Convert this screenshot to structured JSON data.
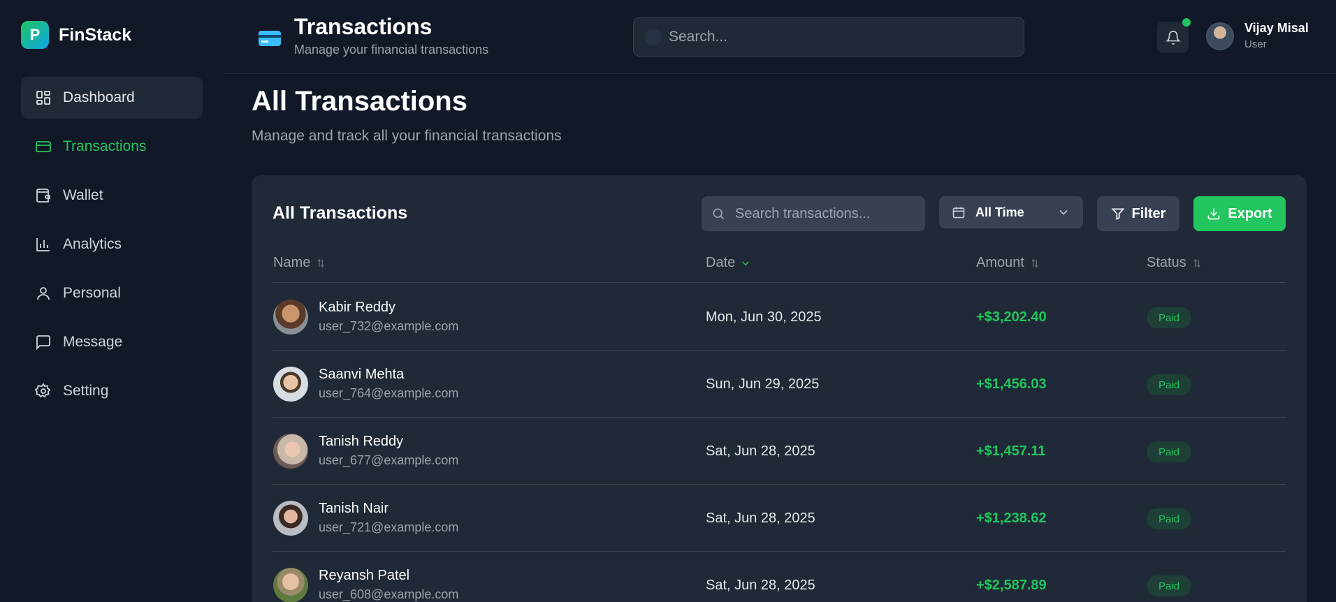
{
  "brand": {
    "logo_letter": "P",
    "name": "FinStack"
  },
  "sidebar": {
    "items": [
      {
        "label": "Dashboard",
        "icon": "dashboard-icon"
      },
      {
        "label": "Transactions",
        "icon": "credit-card-icon"
      },
      {
        "label": "Wallet",
        "icon": "wallet-icon"
      },
      {
        "label": "Analytics",
        "icon": "bar-chart-icon"
      },
      {
        "label": "Personal",
        "icon": "user-icon"
      },
      {
        "label": "Message",
        "icon": "message-icon"
      },
      {
        "label": "Setting",
        "icon": "gear-icon"
      }
    ]
  },
  "header": {
    "title": "Transactions",
    "subtitle": "Manage your financial transactions",
    "search_placeholder": "Search...",
    "user": {
      "name": "Vijay Misal",
      "role": "User"
    }
  },
  "page": {
    "title": "All Transactions",
    "subtitle": "Manage and track all your financial transactions"
  },
  "card": {
    "title": "All Transactions",
    "search_placeholder": "Search transactions...",
    "range_label": "All Time",
    "filter_label": "Filter",
    "export_label": "Export",
    "columns": {
      "name": "Name",
      "date": "Date",
      "amount": "Amount",
      "status": "Status"
    },
    "rows": [
      {
        "name": "Kabir Reddy",
        "email": "user_732@example.com",
        "date": "Mon, Jun 30, 2025",
        "amount": "+$3,202.40",
        "status": "Paid"
      },
      {
        "name": "Saanvi Mehta",
        "email": "user_764@example.com",
        "date": "Sun, Jun 29, 2025",
        "amount": "+$1,456.03",
        "status": "Paid"
      },
      {
        "name": "Tanish Reddy",
        "email": "user_677@example.com",
        "date": "Sat, Jun 28, 2025",
        "amount": "+$1,457.11",
        "status": "Paid"
      },
      {
        "name": "Tanish Nair",
        "email": "user_721@example.com",
        "date": "Sat, Jun 28, 2025",
        "amount": "+$1,238.62",
        "status": "Paid"
      },
      {
        "name": "Reyansh Patel",
        "email": "user_608@example.com",
        "date": "Sat, Jun 28, 2025",
        "amount": "+$2,587.89",
        "status": "Paid"
      }
    ]
  },
  "colors": {
    "accent": "#22c55e",
    "background": "#111827",
    "card": "#1f2937"
  }
}
